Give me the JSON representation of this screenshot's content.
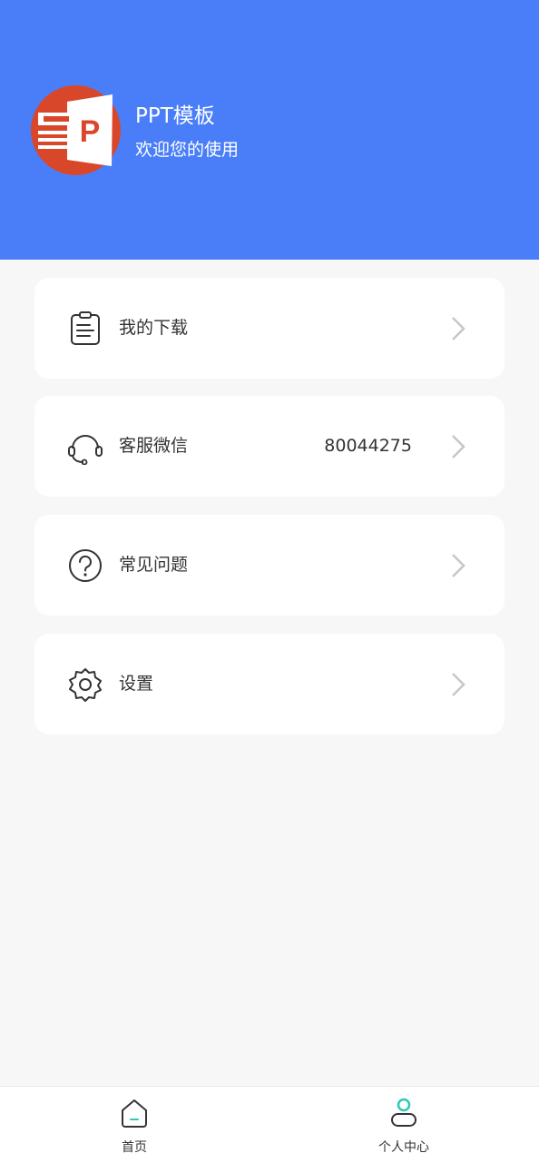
{
  "header": {
    "app_name": "PPT模板",
    "tagline": "欢迎您的使用",
    "background_color": "#4a7ef8",
    "logo_icon": "powerpoint-logo-icon"
  },
  "menu": {
    "items": [
      {
        "label": "我的下载",
        "icon": "clipboard-icon",
        "value": ""
      },
      {
        "label": "客服微信",
        "icon": "headset-icon",
        "value": "80044275"
      },
      {
        "label": "常见问题",
        "icon": "question-circle-icon",
        "value": ""
      },
      {
        "label": "设置",
        "icon": "gear-icon",
        "value": ""
      }
    ]
  },
  "tabbar": {
    "items": [
      {
        "label": "首页",
        "icon": "home-icon",
        "active": false
      },
      {
        "label": "个人中心",
        "icon": "user-icon",
        "active": true
      }
    ],
    "accent_color": "#2fc7b5"
  }
}
